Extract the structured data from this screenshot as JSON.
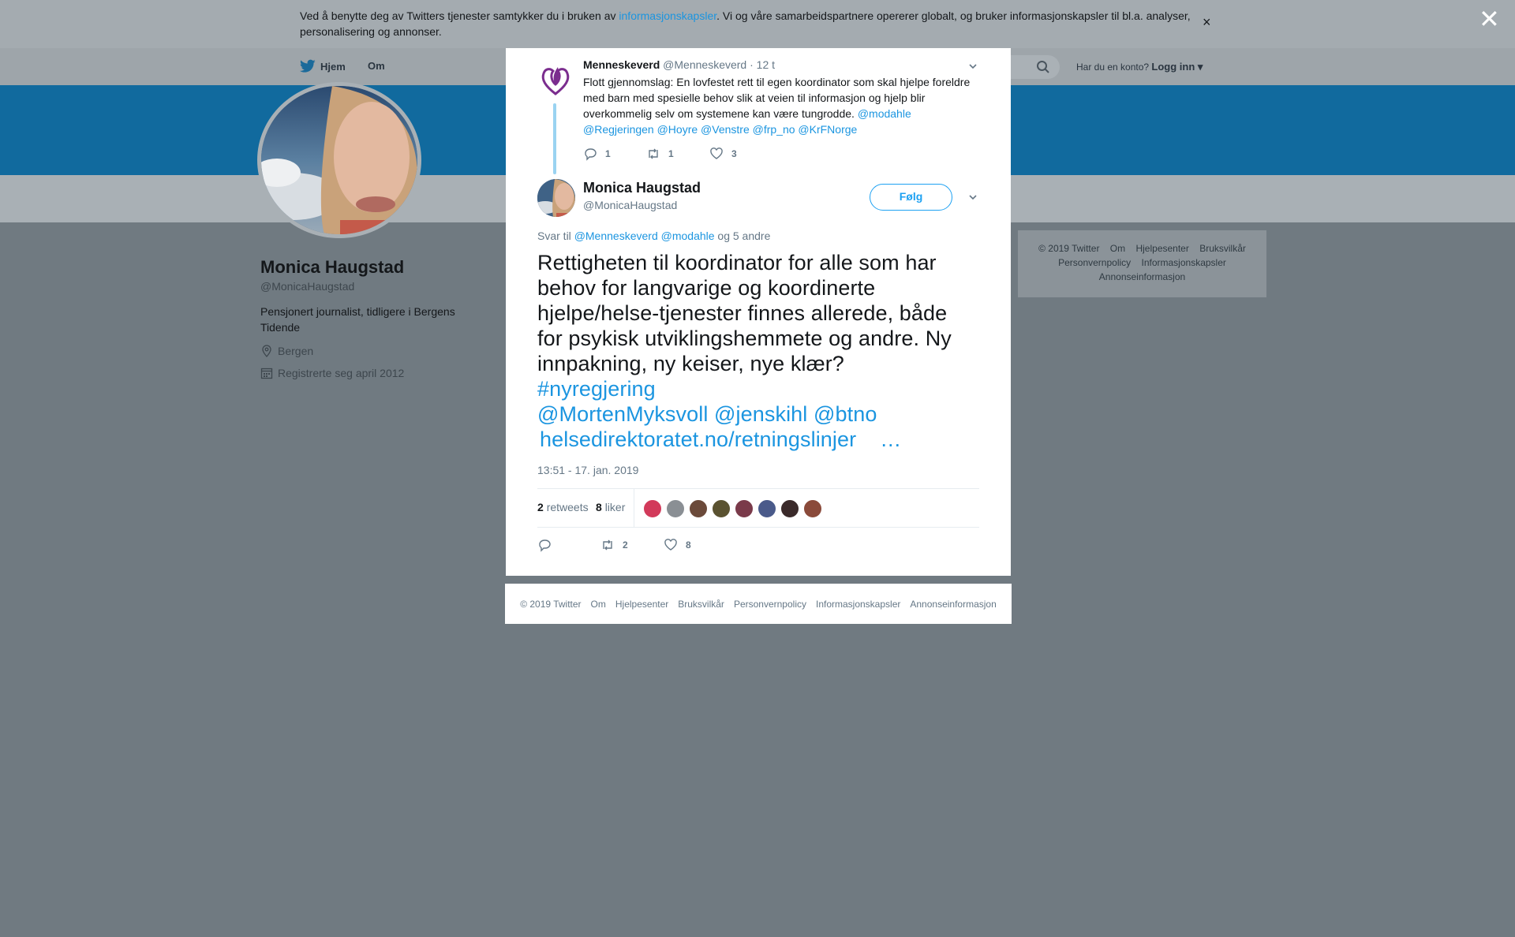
{
  "cookie_bar": {
    "text_before": "Ved å benytte deg av Twitters tjenester samtykker du i bruken av ",
    "link": "informasjonskapsler",
    "text_after": ". Vi og våre samarbeidspartnere opererer globalt, og bruker informasjonskapsler til bl.a. analyser, personalisering og annonser.",
    "close_glyph": "×"
  },
  "overlay": {
    "close_glyph": "✕"
  },
  "nav": {
    "home": "Hjem",
    "about": "Om",
    "login_prompt": "Har du en konto?",
    "login": "Logg inn"
  },
  "profile": {
    "name": "Monica Haugstad",
    "handle": "@MonicaHaugstad",
    "bio": "Pensjonert journalist, tidligere i Bergens Tidende",
    "location": "Bergen",
    "joined": "Registrerte seg april 2012"
  },
  "side_footer": {
    "items": [
      "© 2019 Twitter",
      "Om",
      "Hjelpesenter",
      "Bruksvilkår",
      "Personvernpolicy",
      "Informasjonskapsler",
      "Annonseinformasjon"
    ]
  },
  "parent_tweet": {
    "name": "Menneskeverd",
    "handle": "@Menneskeverd",
    "time": "· 12 t",
    "text": "Flott gjennomslag: En lovfestet rett til egen koordinator som skal hjelpe foreldre med barn med spesielle behov slik at veien til informasjon og hjelp blir overkommelig selv om systemene kan være tungrodde. ",
    "mention_1": "@modahle",
    "mentions_2": "@Regjeringen @Hoyre @Venstre @frp_no @KrFNorge",
    "replies": "1",
    "retweets": "1",
    "likes": "3",
    "accent_color": "#7b2d8e"
  },
  "main_tweet": {
    "name": "Monica Haugstad",
    "handle": "@MonicaHaugstad",
    "follow": "Følg",
    "reply_prefix": "Svar til ",
    "reply_mentions": "@Menneskeverd @modahle",
    "reply_suffix": " og 5 andre",
    "lines": [
      "Rettigheten til koordinator for alle som har",
      "behov for langvarige og koordinerte",
      "hjelpe/helse-tjenester finnes allerede, både",
      "for psykisk utviklingshemmete og andre. Ny",
      "innpakning, ny keiser, nye klær?"
    ],
    "hashtag": "#nyregjering",
    "mentions": "@MortenMyksvoll @jenskihl @btno",
    "link": "helsedirektoratet.no/retningslinjer",
    "ellipsis": "…",
    "timestamp": "13:51 - 17. jan. 2019",
    "retweets_count": "2",
    "retweets_label": "retweets",
    "likes_count": "8",
    "likes_label": "liker",
    "action_retweets": "2",
    "action_likes": "8",
    "liker_colors": [
      "#d23a5a",
      "#8a8f94",
      "#6b4a3a",
      "#5a5230",
      "#7a3a4a",
      "#4a5a8a",
      "#3a2a2a",
      "#8a4a3a"
    ]
  },
  "modal_footer": {
    "items": [
      "© 2019 Twitter",
      "Om",
      "Hjelpesenter",
      "Bruksvilkår",
      "Personvernpolicy",
      "Informasjonskapsler",
      "Annonseinformasjon"
    ]
  },
  "colors": {
    "brand_blue": "#1da1f2",
    "link_blue": "#1b95e0"
  }
}
